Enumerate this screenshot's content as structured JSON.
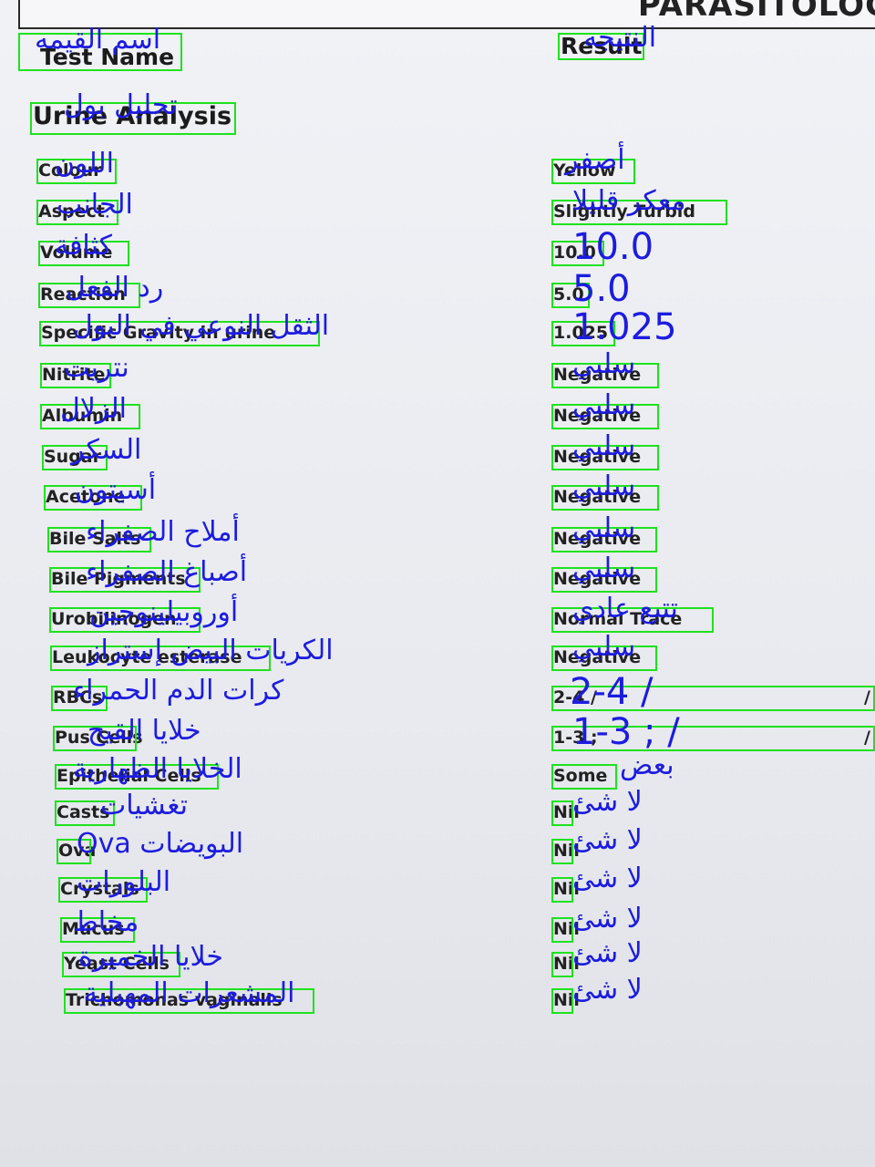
{
  "header": {
    "partial_title": "PARASITOLOG"
  },
  "columns": {
    "test_name": {
      "en": "Test Name",
      "ar": "اسم القيمه"
    },
    "result": {
      "en": "Result",
      "ar": "النتيجه"
    }
  },
  "section": {
    "en": "Urine Analysis",
    "ar": "تحليل بول"
  },
  "rows": [
    {
      "label": "Colour",
      "label_ar": "اللون",
      "value": "Yellow",
      "value_ar": "أصفر"
    },
    {
      "label": "Aspect",
      "label_ar": "الجانب",
      "value": "Slightly Turbid",
      "value_ar": "معكر قليلا"
    },
    {
      "label": "Volume",
      "label_ar": "كثافة",
      "value": "10.0",
      "value_ar": "10.0"
    },
    {
      "label": "Reaction",
      "label_ar": "رد الفعل",
      "value": "5.0",
      "value_ar": "5.0"
    },
    {
      "label": "Specific Gravity in urine",
      "label_ar": "الثقل النوعي في البول",
      "value": "1.025",
      "value_ar": "1.025"
    },
    {
      "label": "Nitrite",
      "label_ar": "نتريت",
      "value": "Negative",
      "value_ar": "سلبي"
    },
    {
      "label": "Albumin",
      "label_ar": "الزلال",
      "value": "Negative",
      "value_ar": "سلبي"
    },
    {
      "label": "Sugar",
      "label_ar": "السكر",
      "value": "Negative",
      "value_ar": "سلبي"
    },
    {
      "label": "Acetone",
      "label_ar": "أسيتون",
      "value": "Negative",
      "value_ar": "سلبي"
    },
    {
      "label": "Bile Salts",
      "label_ar": "أملاح الصفراء",
      "value": "Negative",
      "value_ar": "سلبي"
    },
    {
      "label": "Bile Pigments",
      "label_ar": "أصباغ الصفراء",
      "value": "Negative",
      "value_ar": "سلبي"
    },
    {
      "label": "Urobilinogen",
      "label_ar": "أوروبيلينوجين",
      "value": "Normal Trace",
      "value_ar": "تتبع عادي"
    },
    {
      "label": "Leukocyte esterase",
      "label_ar": "الكريات البيض إستراز",
      "value": "Negative",
      "value_ar": "سلبي"
    },
    {
      "label": "RBCs",
      "label_ar": "كرات الدم الحمراء",
      "value": "2-4 /",
      "value_ar": "2-4 /",
      "value_suffix": "/"
    },
    {
      "label": "Pus Cells",
      "label_ar": "خلايا القيح",
      "value": "1-3 ;",
      "value_ar": "1-3 ; /",
      "value_suffix": "/"
    },
    {
      "label": "Epithelial Cells",
      "label_ar": "الخلايا الظهارية",
      "value": "Some",
      "value_ar": "بعض"
    },
    {
      "label": "Casts",
      "label_ar": "تغشيات",
      "value": "Nil",
      "value_ar": "لا شئ"
    },
    {
      "label": "Ova",
      "label_ar": "البويضات Ova",
      "value": "Nil",
      "value_ar": "لا شئ"
    },
    {
      "label": "Crystals",
      "label_ar": "البلورات",
      "value": "Nil",
      "value_ar": "لا شئ"
    },
    {
      "label": "Mucus",
      "label_ar": "مخاط",
      "value": "Nil",
      "value_ar": "لا شئ"
    },
    {
      "label": "Yeast Cells",
      "label_ar": "خلايا الخميرة",
      "value": "Nil",
      "value_ar": "لا شئ"
    },
    {
      "label": "Trichomonas vaginalis",
      "label_ar": "المشعرات المهبلية",
      "value": "Nil",
      "value_ar": "لا شئ"
    }
  ]
}
